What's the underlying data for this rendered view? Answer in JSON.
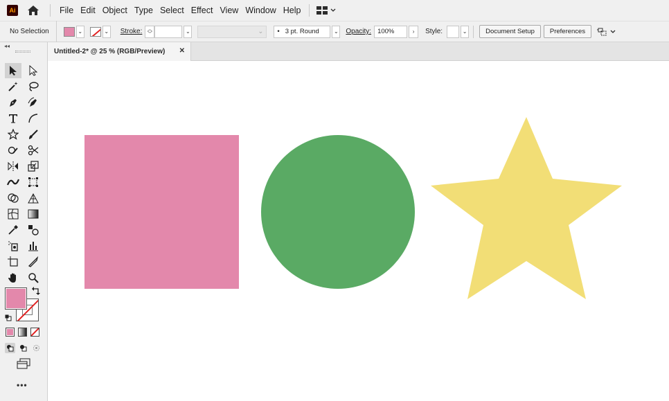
{
  "app": {
    "logo_text": "Ai"
  },
  "menu": {
    "items": [
      "File",
      "Edit",
      "Object",
      "Type",
      "Select",
      "Effect",
      "View",
      "Window",
      "Help"
    ]
  },
  "control_bar": {
    "selection_status": "No Selection",
    "stroke_label": "Stroke:",
    "brush_value": "3 pt. Round",
    "opacity_label": "Opacity:",
    "opacity_value": "100%",
    "style_label": "Style:",
    "document_setup_label": "Document Setup",
    "preferences_label": "Preferences"
  },
  "document": {
    "tab_title": "Untitled-2* @ 25 % (RGB/Preview)"
  },
  "canvas": {
    "shapes": [
      {
        "type": "square",
        "color": "#e388ab"
      },
      {
        "type": "circle",
        "color": "#5aaa64"
      },
      {
        "type": "star",
        "color": "#f2de76"
      }
    ]
  },
  "colors": {
    "fill": "#e388ab",
    "stroke": "none",
    "chrome_bg": "#f0f0f0"
  },
  "toolbar": {
    "more_tools_label": "•••"
  }
}
